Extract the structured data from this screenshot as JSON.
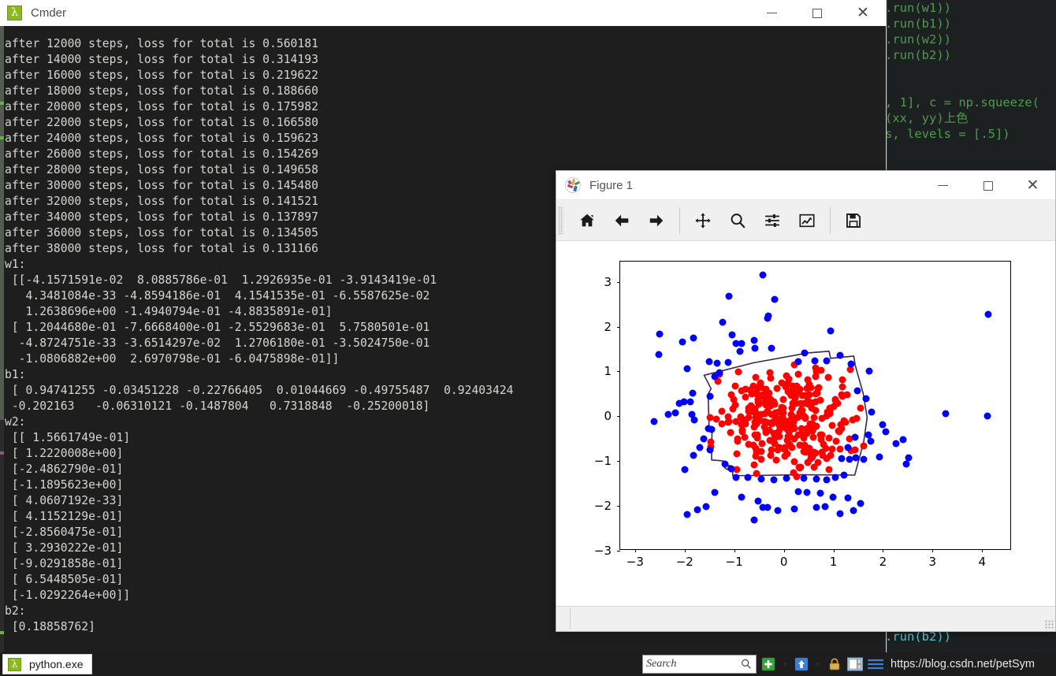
{
  "background_editor": {
    "lines": [
      ".run(w1))",
      ".run(b1))",
      ".run(w2))",
      ".run(b2))",
      "",
      "",
      ", 1], c = np.squeeze(",
      "(xx, yy)上色",
      "s, levels = [.5])"
    ],
    "bottom_line": ".run(b2))",
    "text_color": "#4e9a4e"
  },
  "cmder": {
    "title": "Cmder",
    "icon": "lambda-icon",
    "window_buttons": {
      "minimize": "—",
      "maximize": "□",
      "close": "✕"
    },
    "console_text": "after 12000 steps, loss for total is 0.560181\nafter 14000 steps, loss for total is 0.314193\nafter 16000 steps, loss for total is 0.219622\nafter 18000 steps, loss for total is 0.188660\nafter 20000 steps, loss for total is 0.175982\nafter 22000 steps, loss for total is 0.166580\nafter 24000 steps, loss for total is 0.159623\nafter 26000 steps, loss for total is 0.154269\nafter 28000 steps, loss for total is 0.149658\nafter 30000 steps, loss for total is 0.145480\nafter 32000 steps, loss for total is 0.141521\nafter 34000 steps, loss for total is 0.137897\nafter 36000 steps, loss for total is 0.134505\nafter 38000 steps, loss for total is 0.131166\nw1:\n [[-4.1571591e-02  8.0885786e-01  1.2926935e-01 -3.9143419e-01\n   4.3481084e-33 -4.8594186e-01  4.1541535e-01 -6.5587625e-02\n   1.2638696e+00 -1.4940794e-01 -4.8835891e-01]\n [ 1.2044680e-01 -7.6668400e-01 -2.5529683e-01  5.7580501e-01\n  -4.8724751e-33 -3.6514297e-02  1.2706180e-01 -3.5024750e-01\n  -1.0806882e+00  2.6970798e-01 -6.0475898e-01]]\nb1:\n [ 0.94741255 -0.03451228 -0.22766405  0.01044669 -0.49755487  0.92403424\n -0.202163   -0.06310121 -0.1487804   0.7318848  -0.25200018]\nw2:\n [[ 1.5661749e-01]\n [ 1.2220008e+00]\n [-2.4862790e-01]\n [-1.1895623e+00]\n [ 4.0607192e-33]\n [ 4.1152129e-01]\n [-2.8560475e-01]\n [ 3.2930222e-01]\n [-9.0291858e-01]\n [ 6.5448505e-01]\n [-1.0292264e+00]]\nb2:\n [0.18858762]"
  },
  "figure_window": {
    "title": "Figure 1",
    "icon": "matplotlib-icon",
    "window_buttons": {
      "minimize": "—",
      "maximize": "□",
      "close": "✕"
    },
    "toolbar": [
      {
        "name": "home-icon",
        "label": "Home"
      },
      {
        "name": "back-arrow-icon",
        "label": "Back"
      },
      {
        "name": "forward-arrow-icon",
        "label": "Forward"
      },
      {
        "name": "pan-move-icon",
        "label": "Pan"
      },
      {
        "name": "zoom-magnifier-icon",
        "label": "Zoom to rectangle"
      },
      {
        "name": "subplot-sliders-icon",
        "label": "Configure subplots"
      },
      {
        "name": "edit-curve-chart-icon",
        "label": "Edit axis, curve and image parameters"
      },
      {
        "name": "save-floppy-icon",
        "label": "Save the figure"
      }
    ],
    "statusbar_text": ""
  },
  "chart_data": {
    "type": "scatter",
    "title": "",
    "xlabel": "",
    "ylabel": "",
    "xlim": [
      -3.3,
      4.6
    ],
    "ylim": [
      -3.0,
      3.45
    ],
    "grid": false,
    "legend_position": "none",
    "xticks": [
      -3,
      -2,
      -1,
      0,
      1,
      2,
      3,
      4
    ],
    "xticklabels": [
      "−3",
      "−2",
      "−1",
      "0",
      "1",
      "2",
      "3",
      "4"
    ],
    "yticks": [
      -3,
      -2,
      -1,
      0,
      1,
      2,
      3
    ],
    "yticklabels": [
      "−3",
      "−2",
      "−1",
      "0",
      "1",
      "2",
      "3"
    ],
    "colors": {
      "class_0": "#0000ff",
      "class_1": "#ff0000",
      "decision_boundary": "#44234a"
    },
    "series": [
      {
        "name": "class_0_outer",
        "color": "#0000ff",
        "marker": "o",
        "points": [
          [
            -0.42,
            3.16
          ],
          [
            -1.11,
            2.68
          ],
          [
            -0.19,
            2.6
          ],
          [
            -0.33,
            2.18
          ],
          [
            -0.31,
            2.24
          ],
          [
            4.12,
            2.28
          ],
          [
            -1.23,
            2.09
          ],
          [
            0.95,
            1.91
          ],
          [
            -2.5,
            1.83
          ],
          [
            -1.82,
            1.74
          ],
          [
            -1.05,
            1.82
          ],
          [
            -2.04,
            1.66
          ],
          [
            -0.85,
            1.62
          ],
          [
            -0.97,
            1.63
          ],
          [
            -0.6,
            1.7
          ],
          [
            -0.58,
            1.52
          ],
          [
            -2.52,
            1.38
          ],
          [
            -0.25,
            1.52
          ],
          [
            0.42,
            1.42
          ],
          [
            -1.95,
            1.06
          ],
          [
            -1.5,
            1.21
          ],
          [
            -1.34,
            1.18
          ],
          [
            -1.13,
            1.2
          ],
          [
            -0.88,
            1.44
          ],
          [
            1.13,
            1.35
          ],
          [
            0.63,
            1.24
          ],
          [
            0.87,
            1.23
          ],
          [
            -1.29,
            0.97
          ],
          [
            -1.4,
            0.88
          ],
          [
            1.36,
            1.17
          ],
          [
            -1.84,
            0.52
          ],
          [
            -1.48,
            0.44
          ],
          [
            -2.1,
            0.29
          ],
          [
            -2.02,
            0.32
          ],
          [
            -1.89,
            0.32
          ],
          [
            0.29,
            1.22
          ],
          [
            -2.62,
            -0.11
          ],
          [
            -2.33,
            0.04
          ],
          [
            -2.19,
            0.08
          ],
          [
            -1.86,
            0.04
          ],
          [
            -1.81,
            -0.09
          ],
          [
            1.73,
            1.0
          ],
          [
            -1.52,
            -0.27
          ],
          [
            -1.45,
            -0.3
          ],
          [
            -1.62,
            -0.51
          ],
          [
            -1.7,
            -0.69
          ],
          [
            -1.49,
            -0.75
          ],
          [
            -1.82,
            -0.87
          ],
          [
            -1.99,
            -1.19
          ],
          [
            -1.19,
            -1.06
          ],
          [
            -1.06,
            -1.17
          ],
          [
            1.49,
            0.57
          ],
          [
            1.66,
            0.4
          ],
          [
            1.77,
            0.09
          ],
          [
            1.99,
            -0.19
          ],
          [
            2.06,
            -0.34
          ],
          [
            1.71,
            -0.41
          ],
          [
            1.75,
            -0.55
          ],
          [
            1.44,
            -0.47
          ],
          [
            1.29,
            -0.7
          ],
          [
            2.4,
            -0.53
          ],
          [
            2.27,
            -0.61
          ],
          [
            2.52,
            -0.93
          ],
          [
            1.46,
            -0.93
          ],
          [
            1.17,
            -0.95
          ],
          [
            1.32,
            -0.96
          ],
          [
            1.61,
            -0.97
          ],
          [
            1.93,
            -0.9
          ],
          [
            -0.97,
            -1.37
          ],
          [
            -0.72,
            -1.37
          ],
          [
            -0.45,
            -1.4
          ],
          [
            -0.2,
            -1.42
          ],
          [
            0.05,
            -1.38
          ],
          [
            0.41,
            -1.38
          ],
          [
            0.66,
            -1.4
          ],
          [
            0.87,
            -1.41
          ],
          [
            1.04,
            -1.36
          ],
          [
            1.21,
            -1.32
          ],
          [
            -1.4,
            -1.7
          ],
          [
            -0.86,
            -1.8
          ],
          [
            -0.52,
            -1.9
          ],
          [
            0.29,
            -1.68
          ],
          [
            0.46,
            -1.7
          ],
          [
            0.74,
            -1.72
          ],
          [
            0.99,
            -1.8
          ],
          [
            1.3,
            -1.82
          ],
          [
            0.66,
            -2.03
          ],
          [
            0.84,
            -2.01
          ],
          [
            -0.32,
            -2.04
          ],
          [
            -0.42,
            -2.03
          ],
          [
            -0.12,
            -2.1
          ],
          [
            -1.74,
            -2.08
          ],
          [
            -1.56,
            -2.01
          ],
          [
            -1.95,
            -2.2
          ],
          [
            -0.6,
            -2.32
          ],
          [
            1.13,
            -2.17
          ],
          [
            1.55,
            -1.95
          ],
          [
            1.41,
            -2.1
          ],
          [
            3.26,
            0.05
          ],
          [
            4.1,
            0.01
          ],
          [
            2.47,
            -1.06
          ],
          [
            0.22,
            -2.07
          ]
        ]
      },
      {
        "name": "class_1_inner",
        "color": "#ff0000",
        "marker": "o",
        "n_points": 300,
        "description": "dense red cluster centred near (0.0,-0.1) spanning x in [-1.5,1.6], y in [-1.4,1.3]"
      }
    ],
    "decision_boundary": {
      "color": "#44234a",
      "linewidth": 1.5,
      "closed": true,
      "vertices": [
        [
          -1.6,
          0.9
        ],
        [
          -0.6,
          1.18
        ],
        [
          0.5,
          1.4
        ],
        [
          0.93,
          1.44
        ],
        [
          0.96,
          1.28
        ],
        [
          1.43,
          1.33
        ],
        [
          1.46,
          1.12
        ],
        [
          1.62,
          0.5
        ],
        [
          1.7,
          -0.05
        ],
        [
          1.63,
          -0.6
        ],
        [
          1.52,
          -1.05
        ],
        [
          1.45,
          -1.34
        ],
        [
          0.3,
          -1.33
        ],
        [
          -0.7,
          -1.35
        ],
        [
          -1.02,
          -1.35
        ],
        [
          -1.02,
          -1.15
        ],
        [
          -1.1,
          -1.12
        ],
        [
          -1.12,
          -1.22
        ],
        [
          -1.18,
          -1.18
        ],
        [
          -1.22,
          -1.02
        ],
        [
          -1.45,
          -1.0
        ],
        [
          -1.44,
          -0.3
        ],
        [
          -1.5,
          -0.25
        ],
        [
          -1.52,
          0.48
        ],
        [
          -1.46,
          0.6
        ],
        [
          -1.6,
          0.9
        ]
      ]
    }
  },
  "taskbar": {
    "task_label": "python.exe",
    "task_icon": "lambda-icon",
    "search_placeholder": "Search",
    "tray_icons": [
      "add-plus-icon",
      "caret-down-icon",
      "upload-arrow-icon",
      "caret-down-icon",
      "lock-icon",
      "panel-layout-icon",
      "menu-lines-icon"
    ],
    "url": "https://blog.csdn.net/petSym"
  }
}
